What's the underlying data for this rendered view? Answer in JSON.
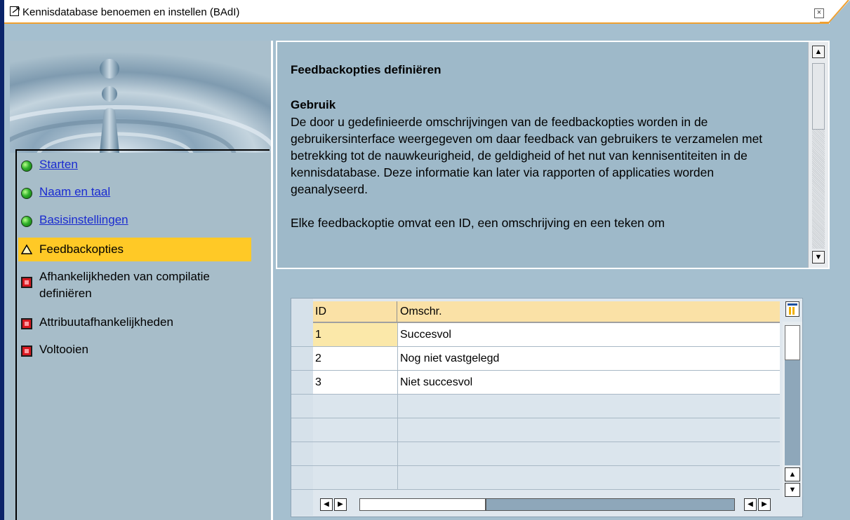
{
  "window": {
    "title": "Kennisdatabase benoemen en instellen (BAdI)",
    "close_glyph": "×",
    "icons": [
      "window-icon",
      "close-icon"
    ]
  },
  "nav": {
    "items": [
      {
        "label": "Starten",
        "status": "green",
        "link": true
      },
      {
        "label": "Naam en taal",
        "status": "green",
        "link": true
      },
      {
        "label": "Basisinstellingen",
        "status": "green",
        "link": true
      },
      {
        "label": "Feedbackopties",
        "status": "warning",
        "link": false,
        "active": true
      },
      {
        "label": "Afhankelijkheden van compilatie definiëren",
        "status": "red",
        "link": false
      },
      {
        "label": "Attribuutafhankelijkheden",
        "status": "red",
        "link": false
      },
      {
        "label": "Voltooien",
        "status": "red",
        "link": false
      }
    ],
    "colors": {
      "link": "#1a2bd0",
      "active_bg": "#ffc926"
    }
  },
  "content": {
    "heading": "Feedbackopties definiëren",
    "subheading": "Gebruik",
    "paragraph1": "De door u gedefinieerde omschrijvingen van de feedbackopties worden in de gebruikersinterface weergegeven om daar feedback van gebruikers te verzamelen met betrekking tot de nauwkeurigheid, de geldigheid of het nut van kennisentiteiten in de kennisdatabase. Deze informatie kan later via rapporten of applicaties worden geanalyseerd.",
    "paragraph2": "Elke feedbackoptie omvat een ID, een omschrijving en een teken om",
    "scroll_up": "▲",
    "scroll_down": "▼"
  },
  "table": {
    "columns": [
      "ID",
      "Omschr."
    ],
    "rows": [
      {
        "id": "1",
        "desc": "Succesvol",
        "selected": true
      },
      {
        "id": "2",
        "desc": "Nog niet vastgelegd"
      },
      {
        "id": "3",
        "desc": "Niet succesvol"
      }
    ],
    "empty_rows": 4,
    "scroll": {
      "up": "▲",
      "down": "▼",
      "left": "◀",
      "right": "▶"
    }
  }
}
